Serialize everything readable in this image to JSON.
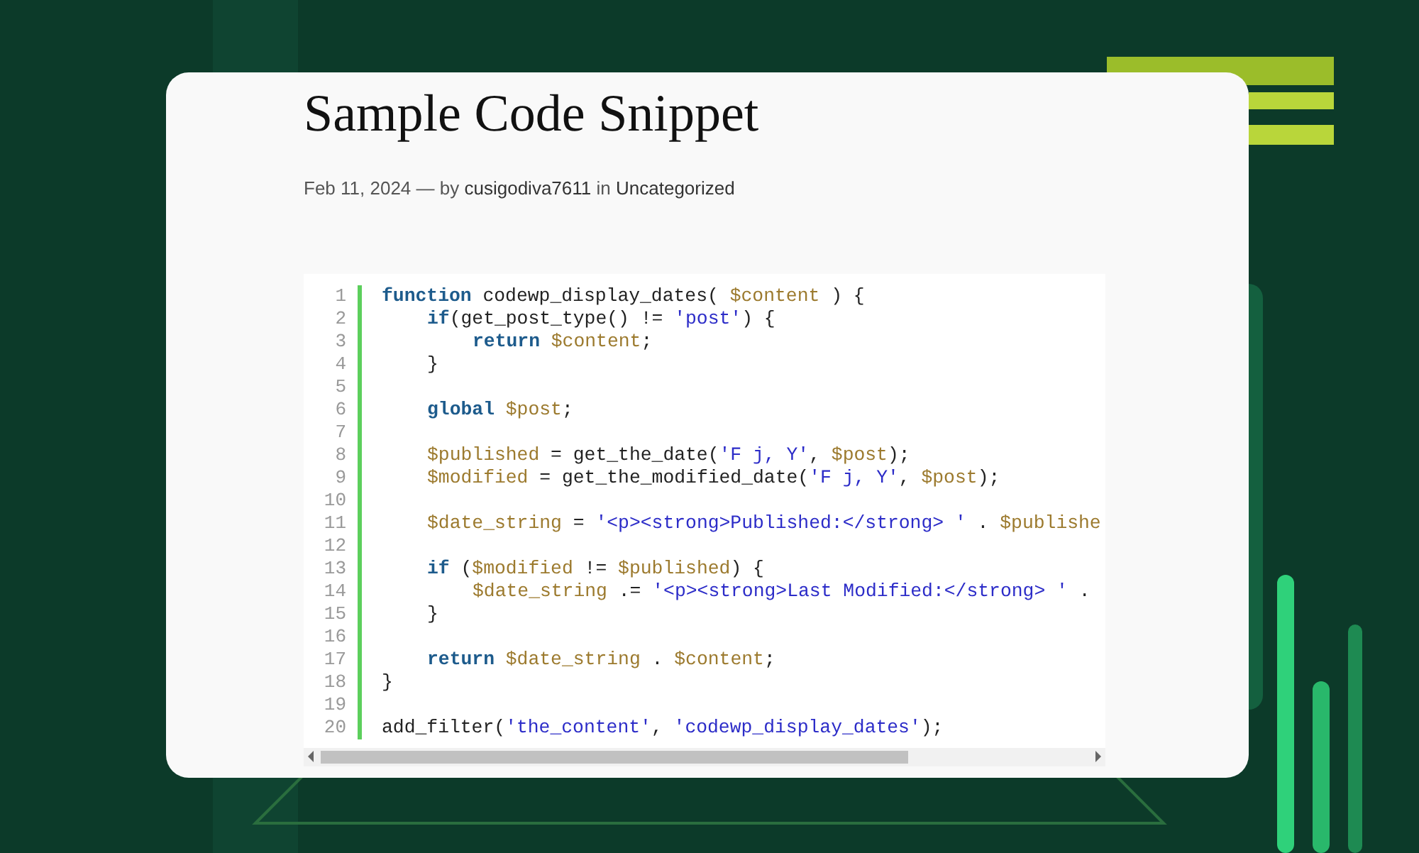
{
  "post": {
    "title": "Sample Code Snippet",
    "date": "Feb 11, 2024",
    "by_text": "— by",
    "author": "cusigodiva7611",
    "in_text": "in",
    "category": "Uncategorized"
  },
  "code": {
    "lines": [
      {
        "number": "1",
        "kind": "top",
        "tokens": [
          {
            "kind": "keyword",
            "text": "function"
          },
          {
            "kind": "plain",
            "text": " codewp_display_dates( "
          },
          {
            "kind": "variable",
            "text": "$content"
          },
          {
            "kind": "plain",
            "text": " ) {"
          }
        ]
      },
      {
        "number": "2",
        "kind": "block",
        "tokens": [
          {
            "kind": "keyword",
            "text": "if"
          },
          {
            "kind": "plain",
            "text": "(get_post_type() != "
          },
          {
            "kind": "string",
            "text": "'post'"
          },
          {
            "kind": "plain",
            "text": ") {"
          }
        ]
      },
      {
        "number": "3",
        "kind": "nested",
        "tokens": [
          {
            "kind": "keyword",
            "text": "return"
          },
          {
            "kind": "variable",
            "text": " $content"
          },
          {
            "kind": "plain",
            "text": ";"
          }
        ]
      },
      {
        "number": "4",
        "kind": "block",
        "tokens": [
          {
            "kind": "plain",
            "text": "}"
          }
        ]
      },
      {
        "number": "5"
      },
      {
        "number": "6",
        "kind": "block",
        "tokens": [
          {
            "kind": "keyword",
            "text": "global"
          },
          {
            "kind": "variable",
            "text": " $post"
          },
          {
            "kind": "plain",
            "text": ";"
          }
        ]
      },
      {
        "number": "7"
      },
      {
        "number": "8",
        "kind": "block",
        "tokens": [
          {
            "kind": "variable",
            "text": "$published"
          },
          {
            "kind": "plain",
            "text": " = get_the_date("
          },
          {
            "kind": "string",
            "text": "'F j, Y'"
          },
          {
            "kind": "plain",
            "text": ", "
          },
          {
            "kind": "variable",
            "text": "$post"
          },
          {
            "kind": "plain",
            "text": ");"
          }
        ]
      },
      {
        "number": "9",
        "kind": "block",
        "tokens": [
          {
            "kind": "variable",
            "text": "$modified"
          },
          {
            "kind": "plain",
            "text": " = get_the_modified_date("
          },
          {
            "kind": "string",
            "text": "'F j, Y'"
          },
          {
            "kind": "plain",
            "text": ", "
          },
          {
            "kind": "variable",
            "text": "$post"
          },
          {
            "kind": "plain",
            "text": ");"
          }
        ]
      },
      {
        "number": "10"
      },
      {
        "number": "11",
        "kind": "block",
        "tokens": [
          {
            "kind": "variable",
            "text": "$date_string"
          },
          {
            "kind": "plain",
            "text": " = "
          },
          {
            "kind": "string",
            "text": "'<p><strong>Published:</strong> '"
          },
          {
            "kind": "plain",
            "text": " . "
          },
          {
            "kind": "variable",
            "text": "$publishe"
          }
        ]
      },
      {
        "number": "12"
      },
      {
        "number": "13",
        "kind": "block",
        "tokens": [
          {
            "kind": "keyword",
            "text": "if"
          },
          {
            "kind": "plain",
            "text": " ("
          },
          {
            "kind": "variable",
            "text": "$modified"
          },
          {
            "kind": "plain",
            "text": " != "
          },
          {
            "kind": "variable",
            "text": "$published"
          },
          {
            "kind": "plain",
            "text": ") {"
          }
        ]
      },
      {
        "number": "14",
        "kind": "nested",
        "tokens": [
          {
            "kind": "variable",
            "text": "$date_string"
          },
          {
            "kind": "plain",
            "text": " .= "
          },
          {
            "kind": "string",
            "text": "'<p><strong>Last Modified:</strong> '"
          },
          {
            "kind": "plain",
            "text": " ."
          }
        ]
      },
      {
        "number": "15",
        "kind": "block",
        "tokens": [
          {
            "kind": "plain",
            "text": "}"
          }
        ]
      },
      {
        "number": "16"
      },
      {
        "number": "17",
        "kind": "block",
        "tokens": [
          {
            "kind": "keyword",
            "text": "return"
          },
          {
            "kind": "variable",
            "text": " $date_string"
          },
          {
            "kind": "plain",
            "text": " . "
          },
          {
            "kind": "variable",
            "text": "$content"
          },
          {
            "kind": "plain",
            "text": ";"
          }
        ]
      },
      {
        "number": "18",
        "kind": "top",
        "tokens": [
          {
            "kind": "plain",
            "text": "}"
          }
        ]
      },
      {
        "number": "19"
      },
      {
        "number": "20",
        "kind": "top",
        "tokens": [
          {
            "kind": "plain",
            "text": "add_filter("
          },
          {
            "kind": "string",
            "text": "'the_content'"
          },
          {
            "kind": "plain",
            "text": ", "
          },
          {
            "kind": "string",
            "text": "'codewp_display_dates'"
          },
          {
            "kind": "plain",
            "text": ");"
          }
        ]
      }
    ]
  }
}
